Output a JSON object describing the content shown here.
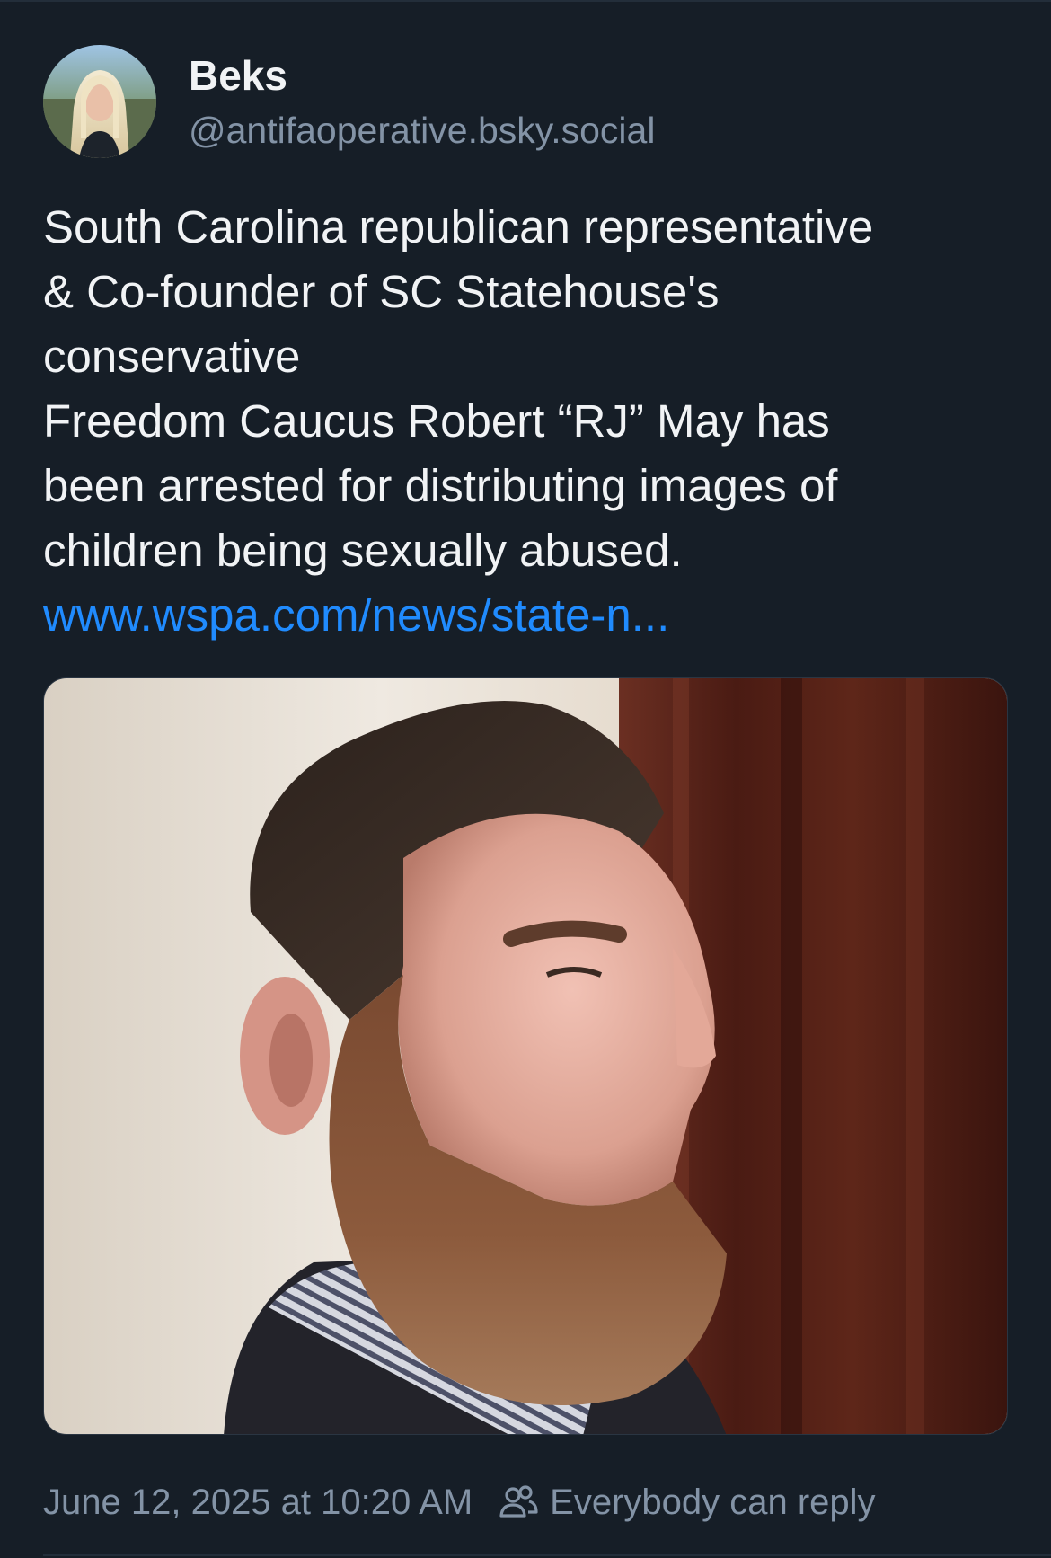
{
  "post": {
    "author": {
      "display_name": "Beks",
      "handle": "@antifaoperative.bsky.social",
      "avatar_icon": "user-avatar-photo"
    },
    "text_lines": [
      "South Carolina republican representative",
      "& Co-founder of SC Statehouse's",
      "conservative",
      "Freedom Caucus Robert “RJ” May has",
      "been arrested for distributing images of",
      "children being sexually abused."
    ],
    "link_text": "www.wspa.com/news/state-n...",
    "media": {
      "type": "photo"
    },
    "timestamp": "June 12, 2025 at 10:20 AM",
    "reply_setting": {
      "icon": "people-icon",
      "label": "Everybody can reply"
    }
  },
  "colors": {
    "background": "#161e27",
    "text": "#f1f3f5",
    "muted": "#8393a6",
    "link": "#208bfe"
  }
}
